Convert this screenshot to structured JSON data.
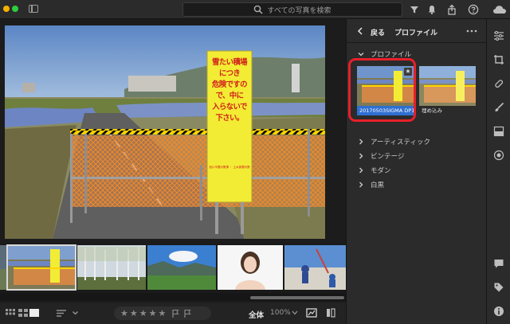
{
  "topbar": {
    "search_placeholder": "すべての写真を検索"
  },
  "panel": {
    "back_label": "戻る",
    "title": "プロファイル",
    "section_open": "プロファイル",
    "profiles": [
      {
        "name": "20170503SIGMA DP1",
        "selected": true
      },
      {
        "name": "埋め込み",
        "selected": false
      }
    ],
    "groups": [
      "アーティスティック",
      "ビンテージ",
      "モダン",
      "白黒"
    ]
  },
  "photo": {
    "sign_text": [
      "雪たい積場につき",
      "危険ですので、中に",
      "入らないで下さい。"
    ],
    "sign_footer": "旭川市雪対策課 ・ 土木部雪対策"
  },
  "bottombar": {
    "rating_stars": [
      "★",
      "★",
      "★",
      "★",
      "★"
    ],
    "zoom_label": "全体",
    "zoom_value": "100%"
  },
  "colors": {
    "accent": "#2f6fd1",
    "highlight": "#e8202a",
    "panel_bg": "#2b2b2b"
  }
}
